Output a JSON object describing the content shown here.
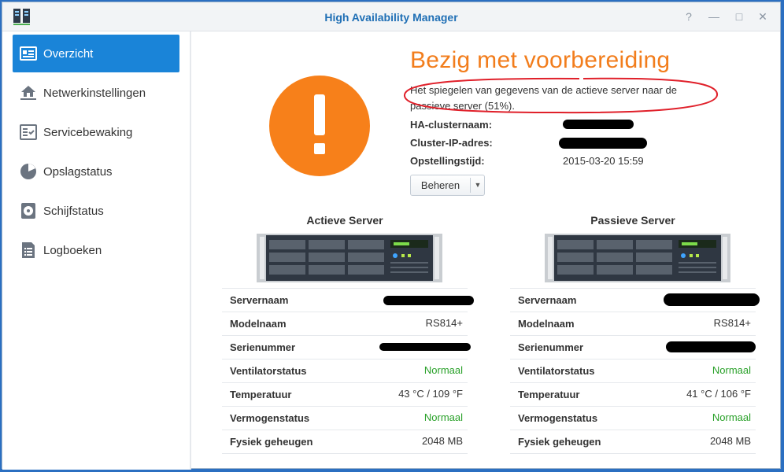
{
  "window": {
    "title": "High Availability Manager"
  },
  "window_controls": [
    "?",
    "—",
    "□",
    "✕"
  ],
  "sidebar": {
    "items": [
      {
        "label": "Overzicht",
        "icon": "overview-icon",
        "active": true
      },
      {
        "label": "Netwerkinstellingen",
        "icon": "network-icon",
        "active": false
      },
      {
        "label": "Servicebewaking",
        "icon": "service-monitor-icon",
        "active": false
      },
      {
        "label": "Opslagstatus",
        "icon": "storage-pie-icon",
        "active": false
      },
      {
        "label": "Schijfstatus",
        "icon": "disk-icon",
        "active": false
      },
      {
        "label": "Logboeken",
        "icon": "log-icon",
        "active": false
      }
    ]
  },
  "status": {
    "title": "Bezig met voorbereiding",
    "description": "Het spiegelen van gegevens van de actieve server naar de passieve server (51%).",
    "progress_percent": 51
  },
  "info": {
    "cluster_name_label": "HA-clusternaam:",
    "cluster_ip_label": "Cluster-IP-adres:",
    "setup_time_label": "Opstellingstijd:",
    "setup_time_value": "2015-03-20 15:59"
  },
  "manage_button": {
    "label": "Beheren"
  },
  "active_server": {
    "title": "Actieve Server",
    "rows": [
      {
        "key": "Servernaam",
        "value": ""
      },
      {
        "key": "Modelnaam",
        "value": "RS814+"
      },
      {
        "key": "Serienummer",
        "value": ""
      },
      {
        "key": "Ventilatorstatus",
        "value": "Normaal"
      },
      {
        "key": "Temperatuur",
        "value": "43 °C / 109 °F"
      },
      {
        "key": "Vermogenstatus",
        "value": "Normaal"
      },
      {
        "key": "Fysiek geheugen",
        "value": "2048 MB"
      }
    ]
  },
  "passive_server": {
    "title": "Passieve Server",
    "rows": [
      {
        "key": "Servernaam",
        "value": ""
      },
      {
        "key": "Modelnaam",
        "value": "RS814+"
      },
      {
        "key": "Serienummer",
        "value": ""
      },
      {
        "key": "Ventilatorstatus",
        "value": "Normaal"
      },
      {
        "key": "Temperatuur",
        "value": "41 °C / 106 °F"
      },
      {
        "key": "Vermogenstatus",
        "value": "Normaal"
      },
      {
        "key": "Fysiek geheugen",
        "value": "2048 MB"
      }
    ]
  },
  "colors": {
    "accent": "#1a84d8",
    "warning": "#f7801a",
    "ok": "#2aa12a",
    "annotation": "#e0202a"
  }
}
